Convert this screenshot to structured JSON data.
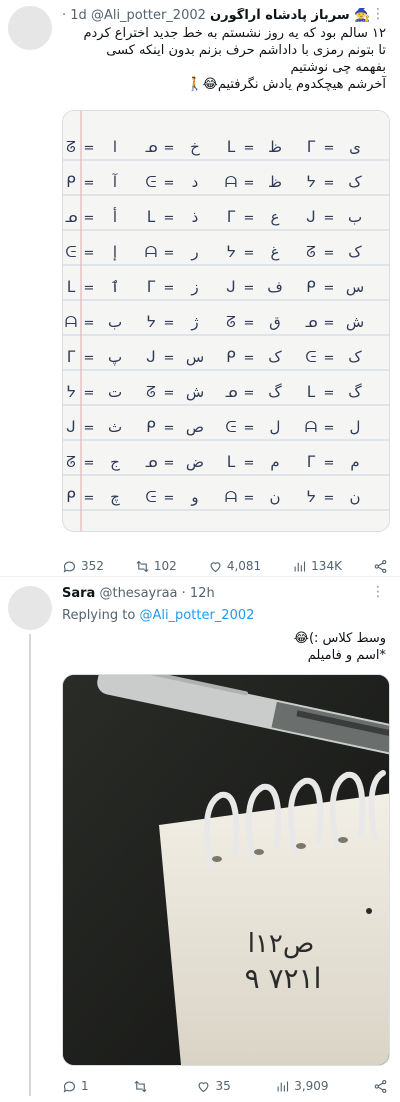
{
  "tweets": [
    {
      "display_name": "سرباز پادشاه آراگورن 🧙",
      "handle": "@Ali_potter_2002",
      "time": "· 1d",
      "text_lines": [
        "۱۲ سالم بود که یه روز نشستم به خط جدید اختراع کردم",
        "تا بتونم رمزی با داداشم حرف بزنم بدون اینکه کسی",
        "بفهمه چی نوشتیم",
        "آخرشم هیچکدوم یادش نگرفتیم😂🚶"
      ],
      "media": {
        "type": "notebook-photo",
        "alphabet_rows": [
          "ا",
          "آ",
          "أ",
          "إ",
          "ٱ",
          "ب",
          "پ",
          "ت",
          "ث",
          "ج",
          "چ"
        ],
        "row_marks": [
          [
            "ی",
            "ظ",
            "خ",
            "ا"
          ],
          [
            "ک",
            "ظ",
            "د",
            "آ"
          ],
          [
            "ب",
            "ع",
            "ذ",
            "أ"
          ],
          [
            "ک",
            "غ",
            "ر",
            "إ"
          ],
          [
            "س",
            "ف",
            "ز",
            "ٱ"
          ],
          [
            "ش",
            "ق",
            "ژ",
            "ب"
          ],
          [
            "ک",
            "ک",
            "س",
            "پ"
          ],
          [
            "گ",
            "گ",
            "ش",
            "ت"
          ],
          [
            "ل",
            "ل",
            "ص",
            "ث"
          ],
          [
            "م",
            "م",
            "ض",
            "ج"
          ],
          [
            "ن",
            "ن",
            "و",
            "چ"
          ]
        ]
      },
      "stats": {
        "replies": "352",
        "retweets": "102",
        "likes": "4,081",
        "views": "134K"
      }
    },
    {
      "display_name": "Sara",
      "handle": "@thesayraa",
      "time": "· 12h",
      "replying_label": "Replying to",
      "replying_handle": "@Ali_potter_2002",
      "text_lines": [
        "وسط کلاس :)😂",
        "*اسم و فامیلم"
      ],
      "media": {
        "type": "photo",
        "note_line1": "ص۱۲ا",
        "note_line2": "۹ ۷۲۱ا"
      },
      "stats": {
        "replies": "1",
        "retweets": "",
        "likes": "35",
        "views": "3,909"
      }
    }
  ]
}
